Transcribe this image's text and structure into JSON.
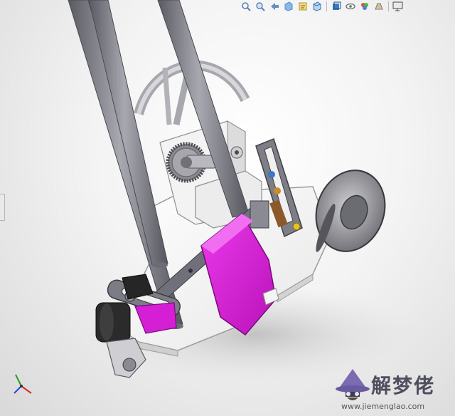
{
  "toolbar": {
    "tools": [
      {
        "name": "zoom-to-fit-icon",
        "color": "#5b7fb5"
      },
      {
        "name": "zoom-to-area-icon",
        "color": "#5b7fb5"
      },
      {
        "name": "previous-view-icon",
        "color": "#6a8bbf"
      },
      {
        "name": "section-view-icon",
        "color": "#4f8fcf"
      },
      {
        "name": "dynamic-annotation-icon",
        "color": "#d8b03a"
      },
      {
        "name": "view-orientation-icon",
        "color": "#5b9bd5"
      },
      {
        "name": "display-style-icon",
        "color": "#3a7fc1"
      },
      {
        "name": "hide-show-items-icon",
        "color": "#6d6d6d"
      },
      {
        "name": "edit-appearance-icon",
        "color": "#d94f4f"
      },
      {
        "name": "apply-scene-icon",
        "color": "#8a8a8a"
      },
      {
        "name": "view-settings-icon",
        "color": "#4b4b4b"
      }
    ]
  },
  "colors": {
    "background_center": "#ffffff",
    "background_edge": "#d9d9d9",
    "metal": "#8e8e96",
    "base_plate": "#f4f4f4",
    "accent_part": "#d51fd5",
    "black_part": "#262626"
  },
  "watermark": {
    "title": "解梦佬",
    "url": "www.jiemenglao.com"
  }
}
